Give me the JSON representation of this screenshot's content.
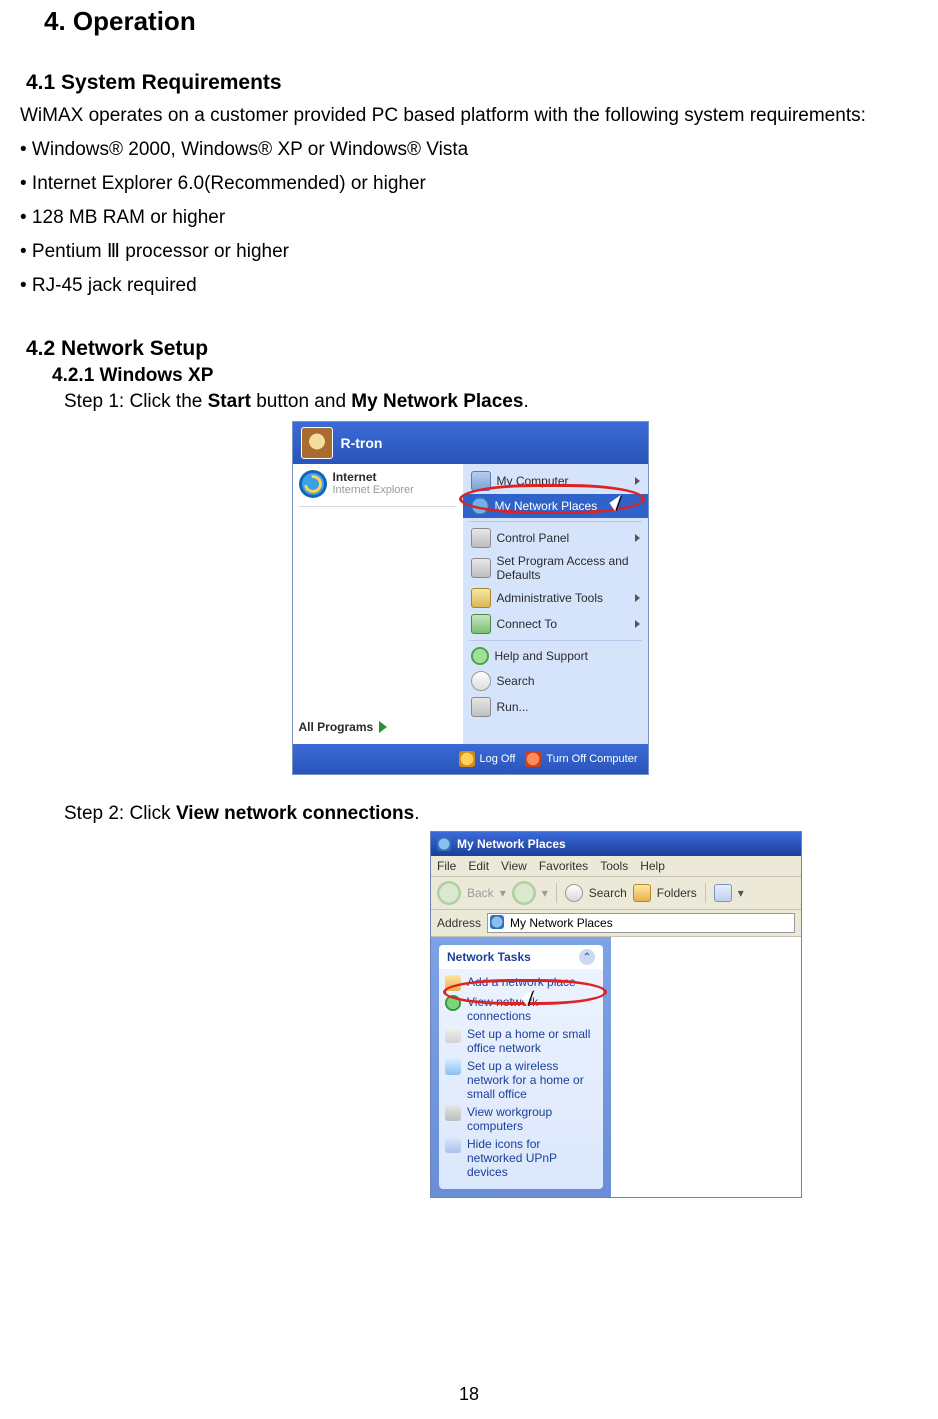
{
  "doc": {
    "h1": "4.  Operation",
    "sec41_h": "4.1  System Requirements",
    "sec41_p": "WiMAX operates on a customer provided PC based platform with the following system requirements:",
    "bullets": [
      "• Windows® 2000, Windows® XP or Windows® Vista",
      "• Internet Explorer 6.0(Recommended) or higher",
      "• 128 MB RAM or higher",
      "• Pentium Ⅲ  processor or higher",
      "• RJ-45 jack required"
    ],
    "sec42_h": "4.2  Network Setup",
    "sec421_h": "4.2.1 Windows XP",
    "step1_pre": "Step 1: Click the ",
    "step1_b1": "Start",
    "step1_mid": " button and ",
    "step1_b2": "My Network Places",
    "step1_post": ".",
    "step2_pre": "Step 2: Click ",
    "step2_b1": "View network connections",
    "step2_post": ".",
    "pagenum": "18"
  },
  "startmenu": {
    "user": "R-tron",
    "ie_title": "Internet",
    "ie_sub": "Internet Explorer",
    "all_programs": "All Programs",
    "right": [
      {
        "label": "My Computer",
        "arrow": true
      },
      {
        "label": "My Network Places",
        "arrow": false,
        "selected": true
      },
      {
        "sep": true
      },
      {
        "label": "Control Panel",
        "arrow": true
      },
      {
        "label": "Set Program Access and Defaults",
        "arrow": false
      },
      {
        "label": "Administrative Tools",
        "arrow": true
      },
      {
        "label": "Connect To",
        "arrow": true
      },
      {
        "sep": true
      },
      {
        "label": "Help and Support",
        "arrow": false
      },
      {
        "label": "Search",
        "arrow": false
      },
      {
        "label": "Run...",
        "arrow": false
      }
    ],
    "logoff": "Log Off",
    "turnoff": "Turn Off Computer"
  },
  "explorer": {
    "title": "My Network Places",
    "menus": [
      "File",
      "Edit",
      "View",
      "Favorites",
      "Tools",
      "Help"
    ],
    "back": "Back",
    "search": "Search",
    "folders": "Folders",
    "addr_label": "Address",
    "addr_value": "My Network Places",
    "taskgroup_title": "Network Tasks",
    "tasks": [
      "Add a network place",
      "View network connections",
      "Set up a home or small office network",
      "Set up a wireless network for a home or small office",
      "View workgroup computers",
      "Hide icons for networked UPnP devices"
    ]
  }
}
